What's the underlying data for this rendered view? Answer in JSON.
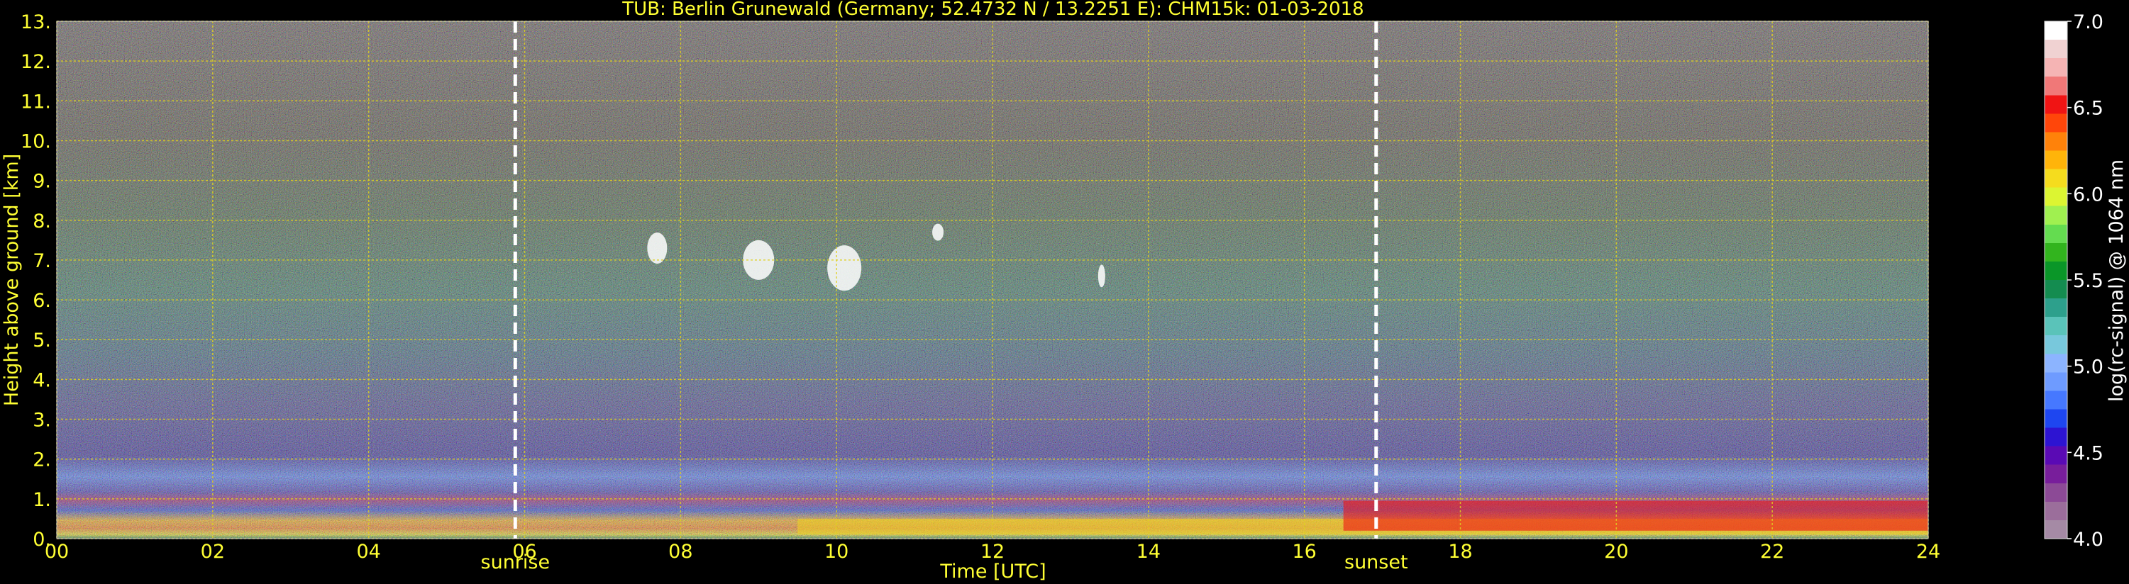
{
  "chart_data": {
    "type": "heatmap",
    "title": "TUB: Berlin Grunewald (Germany; 52.4732 N / 13.2251 E):    CHM15k: 01-03-2018",
    "xlabel": "Time [UTC]",
    "ylabel": "Height above ground [km]",
    "xlim": [
      0,
      24
    ],
    "ylim": [
      0,
      13
    ],
    "x_ticks": [
      0,
      2,
      4,
      6,
      8,
      10,
      12,
      14,
      16,
      18,
      20,
      22,
      24
    ],
    "x_tick_labels": [
      "00",
      "02",
      "04",
      "06",
      "08",
      "10",
      "12",
      "14",
      "16",
      "18",
      "20",
      "22",
      "24"
    ],
    "y_ticks": [
      0,
      1,
      2,
      3,
      4,
      5,
      6,
      7,
      8,
      9,
      10,
      11,
      12,
      13
    ],
    "y_tick_labels": [
      "0.",
      "1.",
      "2.",
      "3.",
      "4.",
      "5.",
      "6.",
      "7.",
      "8.",
      "9.",
      "10.",
      "11.",
      "12.",
      "13."
    ],
    "grid": true,
    "colorbar": {
      "label": "log(rc-signal) @ 1064 nm",
      "range": [
        4.0,
        7.0
      ],
      "ticks": [
        4.0,
        4.5,
        5.0,
        5.5,
        6.0,
        6.5,
        7.0
      ],
      "tick_labels": [
        "4.0",
        "4.5",
        "5.0",
        "5.5",
        "6.0",
        "6.5",
        "7.0"
      ],
      "colors": [
        "#a58aa5",
        "#9b6e9b",
        "#8c4a96",
        "#781e9b",
        "#5a0ab4",
        "#2d14d2",
        "#1e46f0",
        "#4678ff",
        "#6e9bff",
        "#8cb4ff",
        "#78c8dc",
        "#5ac3b9",
        "#2da08c",
        "#148c50",
        "#0a9628",
        "#32b41e",
        "#64dc50",
        "#a0f050",
        "#dcf532",
        "#f5dc1e",
        "#ffb40a",
        "#ff820a",
        "#ff460a",
        "#f01414",
        "#f07878",
        "#f5b4b4",
        "#f0d2d2",
        "#ffffff"
      ]
    },
    "annotations": [
      {
        "label": "sunrise",
        "x": 5.88
      },
      {
        "label": "sunset",
        "x": 16.92
      }
    ]
  }
}
